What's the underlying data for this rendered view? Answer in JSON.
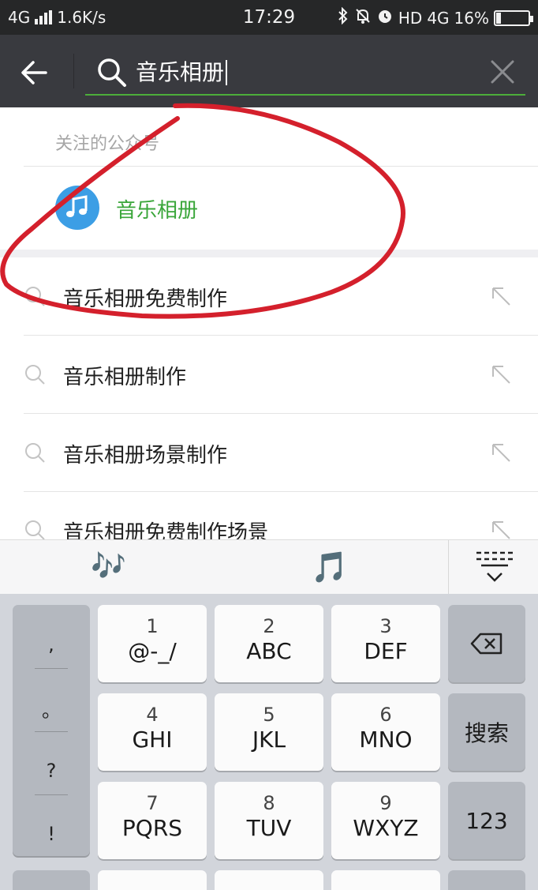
{
  "status_bar": {
    "network": "4G",
    "speed": "1.6K/s",
    "time": "17:29",
    "hd": "HD",
    "network_right": "4G",
    "battery_text": "16%",
    "battery_level": 16
  },
  "search": {
    "query": "音乐相册"
  },
  "accounts": {
    "section_title": "关注的公众号",
    "items": [
      {
        "name": "音乐相册",
        "icon": "music-note-icon"
      }
    ]
  },
  "suggestions": [
    {
      "text": "音乐相册免费制作"
    },
    {
      "text": "音乐相册制作"
    },
    {
      "text": "音乐相册场景制作"
    },
    {
      "text": "音乐相册免费制作场景"
    }
  ],
  "keyboard": {
    "toolbar": {
      "emoji_1": "🎶",
      "emoji_2": "🎵"
    },
    "punctuation": [
      ",",
      "。",
      "?",
      "!"
    ],
    "keys": [
      {
        "num": "1",
        "letters": "@-_/"
      },
      {
        "num": "2",
        "letters": "ABC"
      },
      {
        "num": "3",
        "letters": "DEF"
      },
      {
        "num": "4",
        "letters": "GHI"
      },
      {
        "num": "5",
        "letters": "JKL"
      },
      {
        "num": "6",
        "letters": "MNO"
      },
      {
        "num": "7",
        "letters": "PQRS"
      },
      {
        "num": "8",
        "letters": "TUV"
      },
      {
        "num": "9",
        "letters": "WXYZ"
      }
    ],
    "search_key": "搜索",
    "numbers_key": "123"
  },
  "colors": {
    "header_bg": "#393a3f",
    "accent_green": "#3aa63a",
    "annotation_red": "#d4202c"
  }
}
